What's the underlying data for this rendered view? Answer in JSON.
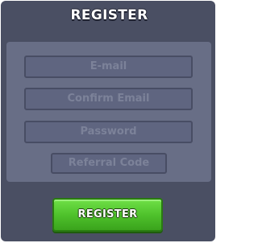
{
  "dialog": {
    "title": "REGISTER"
  },
  "form": {
    "email_placeholder": "E-mail",
    "confirm_email_placeholder": "Confirm Email",
    "password_placeholder": "Password",
    "referral_code_placeholder": "Referral Code"
  },
  "actions": {
    "register_label": "REGISTER"
  },
  "colors": {
    "panel": "#4a4f63",
    "form_box": "#686e86",
    "field": "#5f6580",
    "placeholder_text": "#7c8299",
    "register_button": "#4fc22c"
  }
}
